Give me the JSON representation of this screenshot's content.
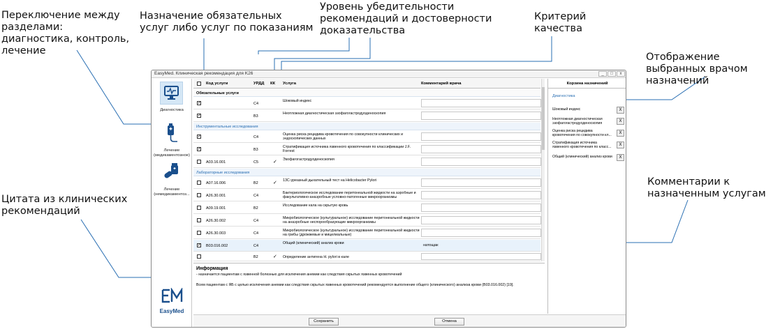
{
  "callouts": {
    "sections": "Переключение между разделами: диагностика, контроль, лечение",
    "mandatory": "Назначение обязательных услуг либо услуг по показаниям",
    "evidence": "Уровень убедительности рекомендаций и достоверности доказательства",
    "quality": "Критерий качества",
    "selected": "Отображение выбранных врачом назначений",
    "comments": "Комментарии к назначенным услугам",
    "citation": "Цитата из клинических рекомендаций"
  },
  "window": {
    "title": "EasyMed. Клиническая рекомендация для K26",
    "buttons": [
      "_",
      "□",
      "x"
    ]
  },
  "sidebar": {
    "items": [
      {
        "label": "Диагностика",
        "icon": "monitor-stethoscope-icon",
        "active": true
      },
      {
        "label": "Лечение (медикаментозное)",
        "icon": "iv-drip-icon",
        "active": false
      },
      {
        "label": "Лечение (немедикаментоз...",
        "icon": "pills-icon",
        "active": false
      }
    ],
    "logo_text": "EasyMed"
  },
  "table": {
    "headers": {
      "code": "Код услуги",
      "urdd": "УРДД",
      "kk": "КК",
      "service": "Услуга",
      "comment": "Комментарий врача"
    },
    "sections": [
      {
        "title": "Обязательные услуги",
        "bold": true
      },
      {
        "title": "Инструментальные исследования",
        "bold": false
      },
      {
        "title": "Лабораторные исследования",
        "bold": false
      }
    ],
    "rows": [
      {
        "checked": true,
        "code": "",
        "urdd": "C4",
        "kk": "",
        "service": "Шоковый индекс",
        "comment": ""
      },
      {
        "checked": true,
        "code": "",
        "urdd": "B3",
        "kk": "",
        "service": "Неотложная диагностическая эзофагогастродуоденоскопия",
        "comment": ""
      },
      {
        "checked": true,
        "code": "",
        "urdd": "C4",
        "kk": "",
        "service": "Оценка риска рецидива кровотечения по совокупности клинических и эндоскопических данных",
        "comment": ""
      },
      {
        "checked": true,
        "code": "",
        "urdd": "B3",
        "kk": "",
        "service": "Стратификация источника язвенного кровотечения по классификации J.F. Forrest",
        "comment": ""
      },
      {
        "checked": false,
        "code": "A03.16.001",
        "urdd": "C5",
        "kk": "✓",
        "service": "Эзофагогастродуоденоскопия",
        "comment": ""
      },
      {
        "checked": false,
        "code": "A07.16.006",
        "urdd": "B2",
        "kk": "✓",
        "service": "13С-уреазный дыхательный тест на Helicobacter Pylori",
        "comment": ""
      },
      {
        "checked": false,
        "code": "A26.30.001",
        "urdd": "C4",
        "kk": "",
        "service": "Бактериологическое исследование перитонеальной жидкости на аэробные и факультативно-анаэробные условно-патогенные микроорганизмы",
        "comment": ""
      },
      {
        "checked": false,
        "code": "A09.19.001",
        "urdd": "B2",
        "kk": "",
        "service": "Исследование кала на скрытую кровь",
        "comment": ""
      },
      {
        "checked": false,
        "code": "A26.30.002",
        "urdd": "C4",
        "kk": "",
        "service": "Микробиологическое (культуральное) исследование перитонеальной жидкости на анаэробные неспорообразующие микроорганизмы",
        "comment": ""
      },
      {
        "checked": false,
        "code": "A26.30.003",
        "urdd": "C4",
        "kk": "",
        "service": "Микробиологическое (культуральное) исследование перитонеальной жидкости на грибы (дрожжевые и мицелиальные)",
        "comment": ""
      },
      {
        "checked": true,
        "code": "B03.016.002",
        "urdd": "C4",
        "kk": "",
        "service": "Общий (клинический) анализ крови",
        "comment": "натощак"
      },
      {
        "checked": false,
        "code": "",
        "urdd": "B2",
        "kk": "✓",
        "service": "Определение антигена H. pylori в кале",
        "comment": ""
      }
    ]
  },
  "info": {
    "heading": "Информация",
    "line1": "- назначается пациентам с язвенной болезнью для исключения анемии как следствия скрытых язвенных кровотечений",
    "line2": "Всем пациентам с ЯБ с целью исключения анемии как следствия скрытых язвенных кровотечений рекомендуется выполнение общего (клинического) анализа крови (B03.016.002) [19]."
  },
  "footer": {
    "save": "Сохранить",
    "cancel": "Отмена"
  },
  "cart": {
    "title": "Корзина назначений",
    "category": "Диагностика",
    "items": [
      "Шоковый индекс",
      "Неотложная диагностическая эзофагогастродуоденоскопия",
      "Оценка риска рецидива кровотечения по совокупности кл...",
      "Стратификация источника язвенного кровотечения по класс...",
      "Общий (клинический) анализ крови"
    ],
    "remove_label": "X"
  },
  "colors": {
    "accent": "#2a6fb3",
    "brand": "#1a4f8c",
    "callout_line": "#2a6fb3"
  }
}
